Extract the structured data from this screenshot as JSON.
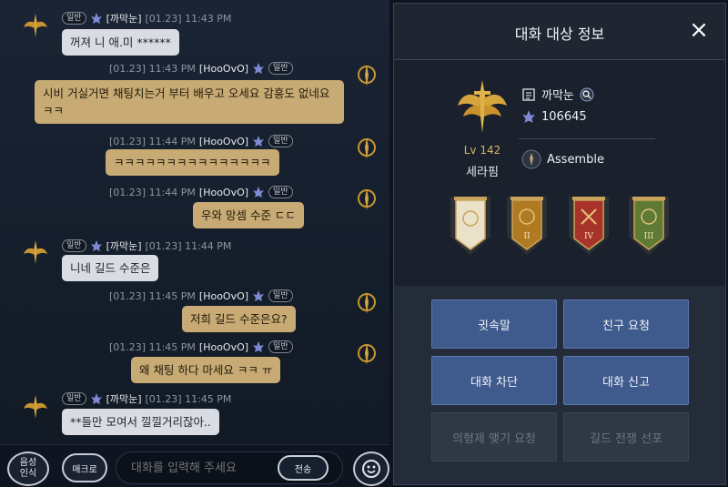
{
  "chat": {
    "messages": [
      {
        "side": "left",
        "badge": "일반",
        "name": "[까막눈]",
        "time": "[01.23] 11:43 PM",
        "text": "꺼져 니 애.미 ******"
      },
      {
        "side": "right",
        "badge": "일반",
        "name": "[HooOvO]",
        "time": "[01.23] 11:43 PM",
        "text": "시비 거실거면 채팅치는거 부터 배우고 오세요 감흥도 없네요 ㅋㅋ"
      },
      {
        "side": "right",
        "badge": "일반",
        "name": "[HooOvO]",
        "time": "[01.23] 11:44 PM",
        "text": "ㅋㅋㅋㅋㅋㅋㅋㅋㅋㅋㅋㅋㅋㅋㅋ"
      },
      {
        "side": "right",
        "badge": "일반",
        "name": "[HooOvO]",
        "time": "[01.23] 11:44 PM",
        "text": "우와 망셈 수준 ㄷㄷ"
      },
      {
        "side": "left",
        "badge": "일반",
        "name": "[까막눈]",
        "time": "[01.23] 11:44 PM",
        "text": "니네 길드 수준은"
      },
      {
        "side": "right",
        "badge": "일반",
        "name": "[HooOvO]",
        "time": "[01.23] 11:45 PM",
        "text": "저희 길드 수준은요?"
      },
      {
        "side": "right",
        "badge": "일반",
        "name": "[HooOvO]",
        "time": "[01.23] 11:45 PM",
        "text": "왜 채팅 하다 마세요 ㅋㅋ ㅠ"
      },
      {
        "side": "left",
        "badge": "일반",
        "name": "[까막눈]",
        "time": "[01.23] 11:45 PM",
        "text": "**들만 모여서 낄낄거리잖아.."
      }
    ],
    "voice_label_1": "음성",
    "voice_label_2": "인식",
    "macro_label": "매크로",
    "input_placeholder": "대화를 입력해 주세요",
    "send_label": "전송"
  },
  "panel": {
    "title": "대화 대상 정보",
    "close_icon": "×",
    "level": "Lv 142",
    "class_name": "세라핌",
    "char_name": "까막눈",
    "power": "106645",
    "guild": "Assemble",
    "banners": [
      {
        "numeral": "",
        "color": "#e9e1c8"
      },
      {
        "numeral": "II",
        "color": "#b07a22"
      },
      {
        "numeral": "IV",
        "color": "#a8332a"
      },
      {
        "numeral": "III",
        "color": "#5f7a34"
      }
    ],
    "buttons": [
      {
        "label": "귓속말",
        "enabled": true
      },
      {
        "label": "친구 요청",
        "enabled": true
      },
      {
        "label": "대화 차단",
        "enabled": true
      },
      {
        "label": "대화 신고",
        "enabled": true
      },
      {
        "label": "의형제 맺기 요청",
        "enabled": false
      },
      {
        "label": "길드 전쟁 선포",
        "enabled": false
      }
    ]
  },
  "colors": {
    "accent": "#3f5a8c",
    "gold": "#d9b463",
    "tan_bubble": "#c7aa74"
  }
}
